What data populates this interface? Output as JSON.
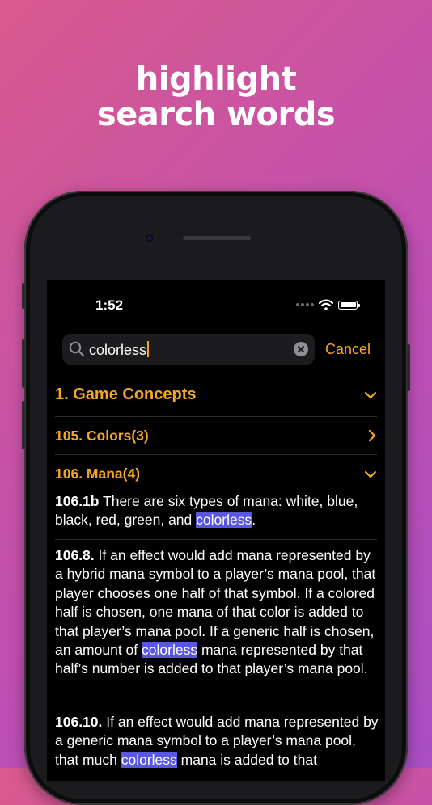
{
  "headline": {
    "line1": "highlight",
    "line2": "search words"
  },
  "status": {
    "time": "1:52"
  },
  "search": {
    "query": "colorless",
    "cancel_label": "Cancel"
  },
  "sections": [
    {
      "title": "1. Game Concepts",
      "expanded": true
    }
  ],
  "rows": [
    {
      "title": "105. Colors(3)",
      "expanded": false
    },
    {
      "title": "106. Mana(4)",
      "expanded": true
    }
  ],
  "rules": [
    {
      "id": "106.1b",
      "parts": [
        "There are six types of mana: white, blue, black, red, green, and ",
        "colorless",
        "."
      ]
    },
    {
      "id": "106.8.",
      "parts": [
        "If an effect would add mana represented by a hybrid mana symbol to a player’s mana pool, that player chooses one half of that symbol. If a colored half is chosen, one mana of that color is added to that player’s mana pool. If a generic half is chosen, an amount of ",
        "colorless",
        " mana represented by that half’s number is added to that player’s mana pool."
      ]
    },
    {
      "id": "106.10.",
      "parts": [
        "If an effect would add mana represented by a generic mana symbol to a player’s mana pool, that much ",
        "colorless",
        " mana is added to that"
      ]
    }
  ],
  "colors": {
    "accent": "#f5a623",
    "highlight": "#5956e0",
    "background": "#000000"
  }
}
